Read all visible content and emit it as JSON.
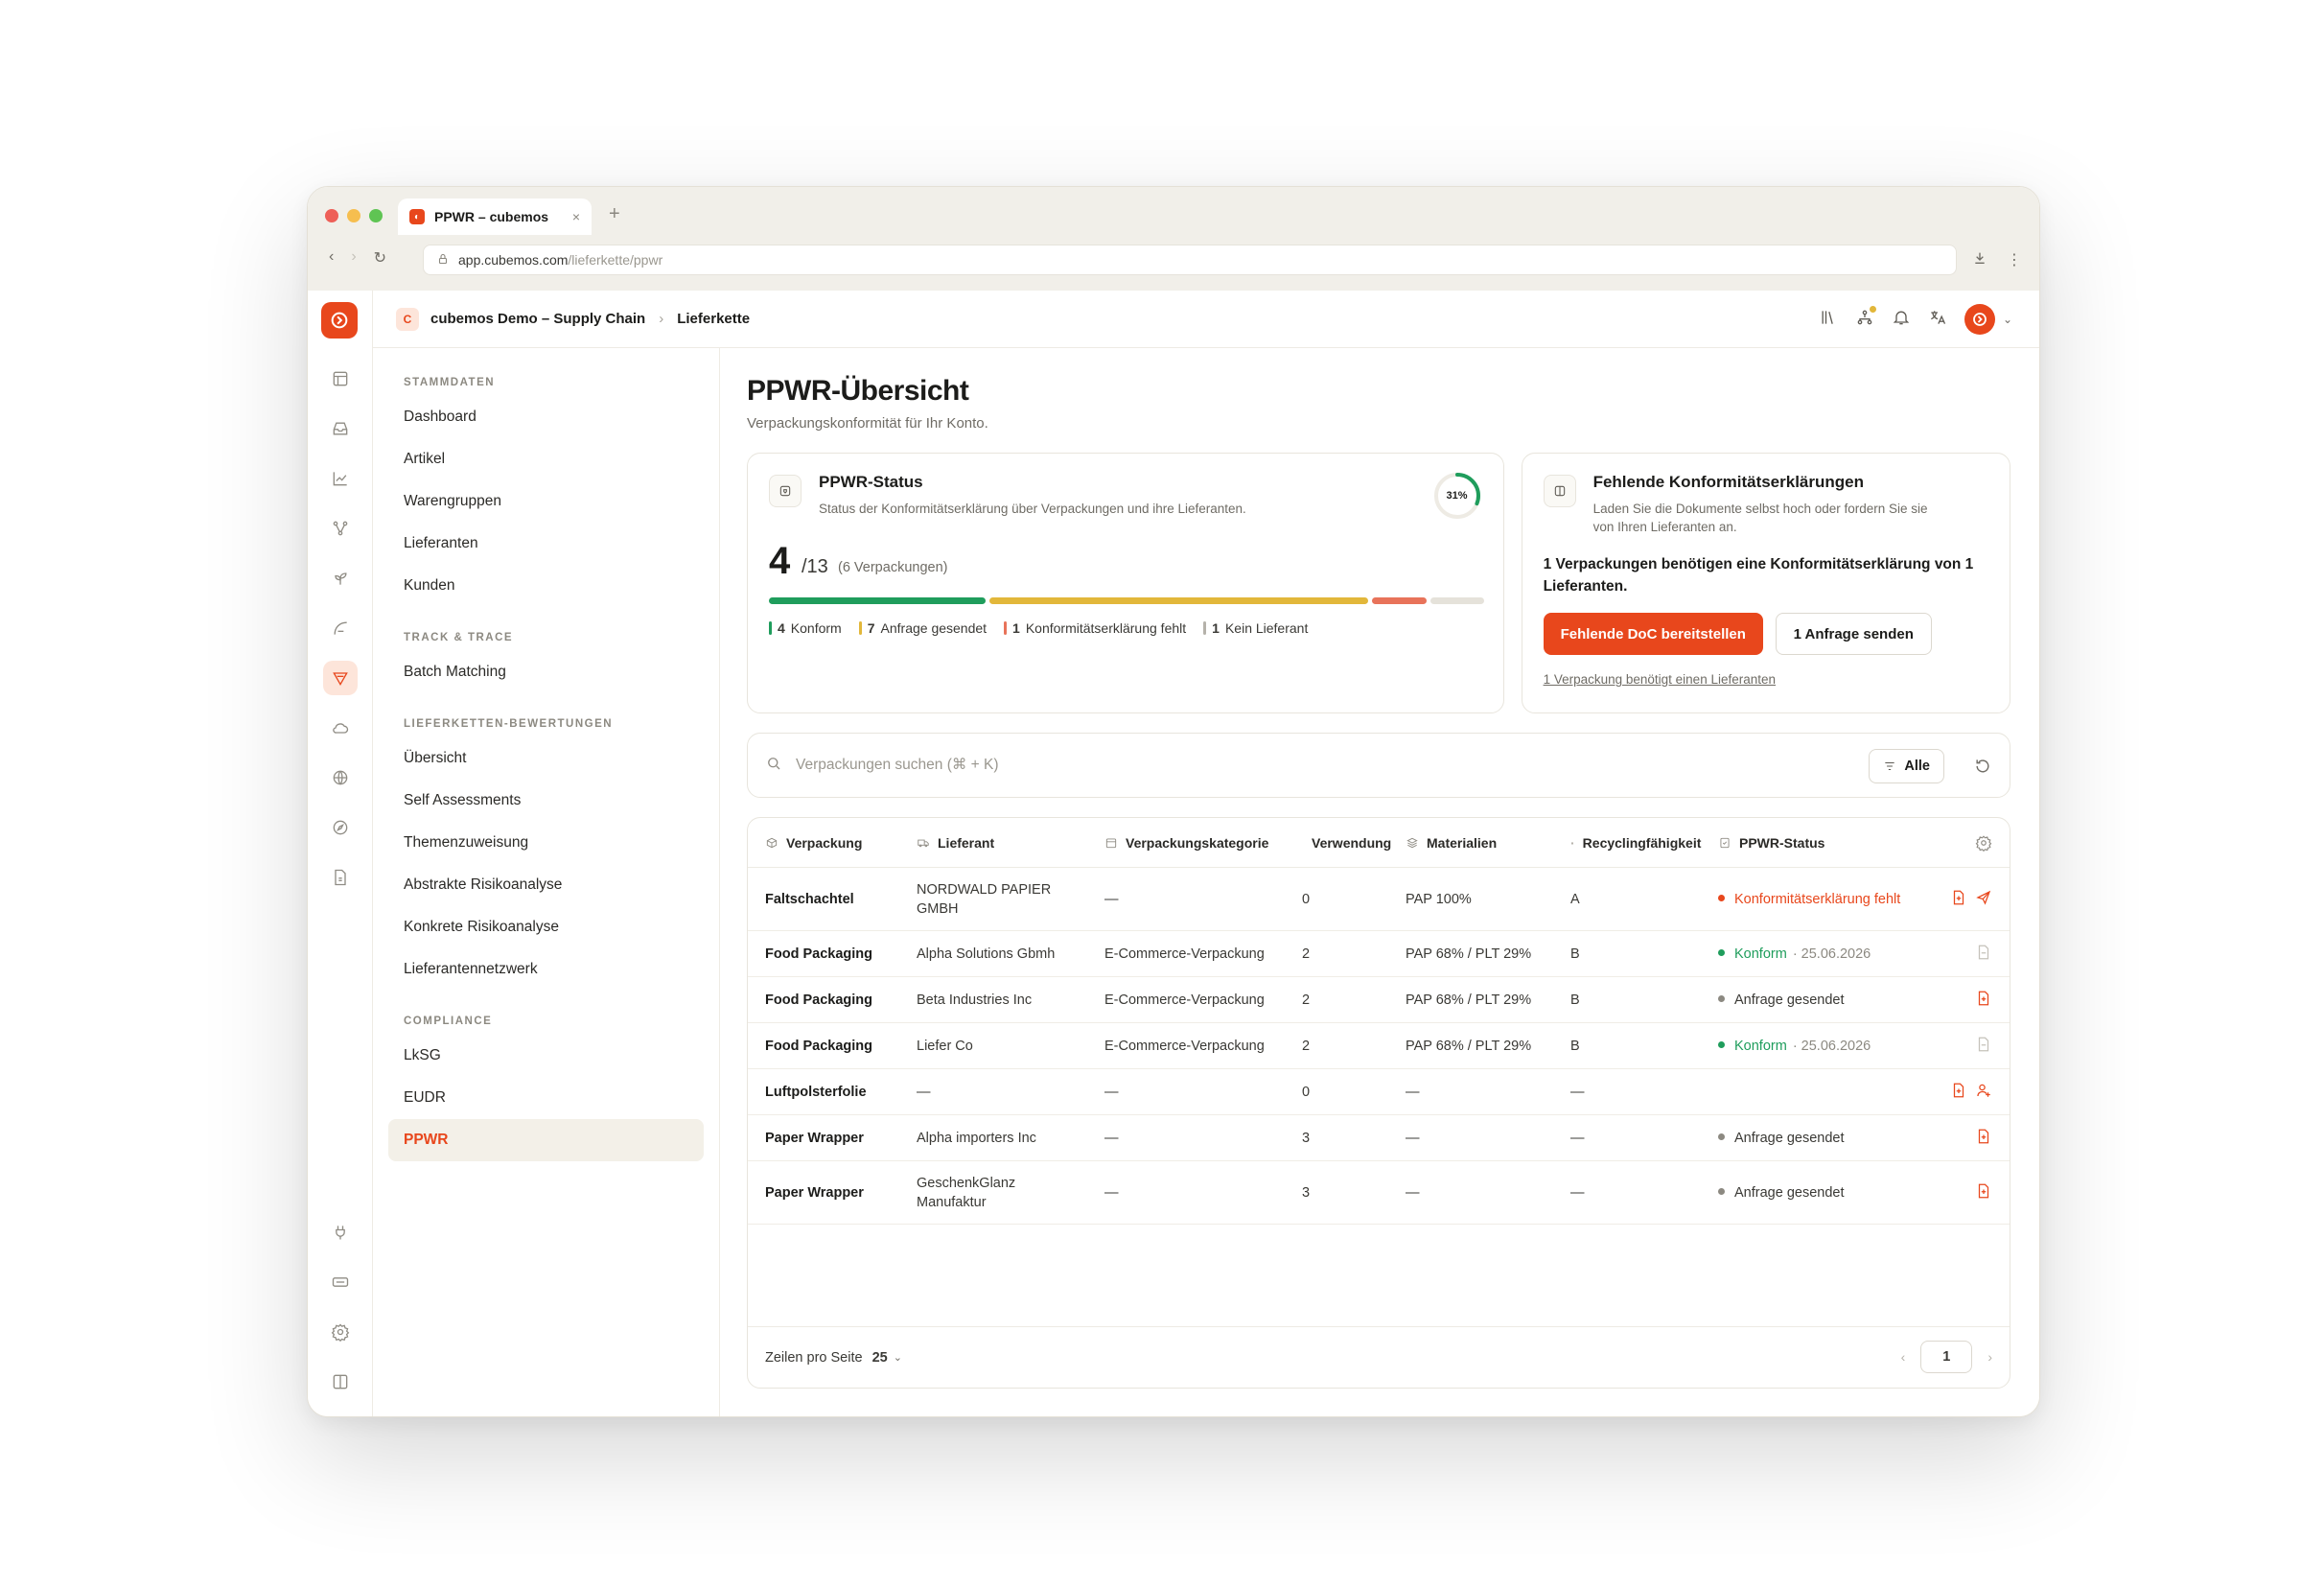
{
  "browser": {
    "tab_title": "PPWR – cubemos",
    "tab_close": "×",
    "new_tab": "+",
    "url_host": "app.cubemos.com",
    "url_path": "/lieferkette/ppwr"
  },
  "topbar": {
    "org_badge": "C",
    "org_name": "cubemos Demo – Supply Chain",
    "breadcrumb_sep": "›",
    "breadcrumb_current": "Lieferkette"
  },
  "menu": {
    "sections": [
      {
        "title": "STAMMDATEN",
        "items": [
          "Dashboard",
          "Artikel",
          "Warengruppen",
          "Lieferanten",
          "Kunden"
        ]
      },
      {
        "title": "TRACK & TRACE",
        "items": [
          "Batch Matching"
        ]
      },
      {
        "title": "LIEFERKETTEN-BEWERTUNGEN",
        "items": [
          "Übersicht",
          "Self Assessments",
          "Themenzuweisung",
          "Abstrakte Risikoanalyse",
          "Konkrete Risikoanalyse",
          "Lieferantennetzwerk"
        ]
      },
      {
        "title": "COMPLIANCE",
        "items": [
          "LkSG",
          "EUDR",
          "PPWR"
        ]
      }
    ],
    "active_item": "PPWR"
  },
  "page": {
    "title": "PPWR-Übersicht",
    "subtitle": "Verpackungskonformität für Ihr Konto."
  },
  "status_card": {
    "title": "PPWR-Status",
    "description": "Status der Konformitätserklärung über Verpackungen und ihre Lieferanten.",
    "ring_label": "31%",
    "ring_fraction": 0.31,
    "big_number": "4",
    "total": "/13",
    "count_note": "(6 Verpackungen)",
    "segments": [
      {
        "label": "Konform",
        "count": "4",
        "color": "#1f9d5c",
        "weight": 4
      },
      {
        "label": "Anfrage gesendet",
        "count": "7",
        "color": "#e2b73a",
        "weight": 7
      },
      {
        "label": "Konformitätserklärung fehlt",
        "count": "1",
        "color": "#e8735a",
        "weight": 1
      },
      {
        "label": "Kein Lieferant",
        "count": "1",
        "color": "#e5e2da",
        "weight": 1
      }
    ]
  },
  "missing_card": {
    "title": "Fehlende Konformitätserklärungen",
    "description_line1": "Laden Sie die Dokumente selbst hoch oder fordern Sie sie",
    "description_line2": "von Ihren Lieferanten an.",
    "bold_text": "1 Verpackungen benötigen eine Konformitätserklärung von 1 Lieferanten.",
    "primary_button": "Fehlende DoC bereitstellen",
    "secondary_button": "1 Anfrage senden",
    "link": "1 Verpackung benötigt einen Lieferanten"
  },
  "search": {
    "placeholder": "Verpackungen suchen (⌘ + K)",
    "filter_label": "Alle"
  },
  "table": {
    "columns": [
      "Verpackung",
      "Lieferant",
      "Verpackungskategorie",
      "Verwendung",
      "Materialien",
      "Recyclingfähigkeit",
      "PPWR-Status"
    ],
    "rows": [
      {
        "packaging": "Faltschachtel",
        "supplier": "NORDWALD PAPIER GMBH",
        "category": "—",
        "usage": "0",
        "materials": "PAP 100%",
        "recycling": "A",
        "status": "Konformitätserklärung fehlt",
        "status_type": "red",
        "date": ""
      },
      {
        "packaging": "Food Packaging",
        "supplier": "Alpha Solutions Gbmh",
        "category": "E-Commerce-Verpackung",
        "usage": "2",
        "materials": "PAP 68% / PLT 29%",
        "recycling": "B",
        "status": "Konform",
        "status_type": "green",
        "date": "· 25.06.2026"
      },
      {
        "packaging": "Food Packaging",
        "supplier": "Beta Industries Inc",
        "category": "E-Commerce-Verpackung",
        "usage": "2",
        "materials": "PAP 68% / PLT 29%",
        "recycling": "B",
        "status": "Anfrage gesendet",
        "status_type": "grey",
        "date": ""
      },
      {
        "packaging": "Food Packaging",
        "supplier": "Liefer Co",
        "category": "E-Commerce-Verpackung",
        "usage": "2",
        "materials": "PAP 68% / PLT 29%",
        "recycling": "B",
        "status": "Konform",
        "status_type": "green",
        "date": "· 25.06.2026"
      },
      {
        "packaging": "Luftpolsterfolie",
        "supplier": "—",
        "category": "—",
        "usage": "0",
        "materials": "—",
        "recycling": "—",
        "status": "",
        "status_type": "none",
        "date": ""
      },
      {
        "packaging": "Paper Wrapper",
        "supplier": "Alpha importers Inc",
        "category": "—",
        "usage": "3",
        "materials": "—",
        "recycling": "—",
        "status": "Anfrage gesendet",
        "status_type": "grey",
        "date": ""
      },
      {
        "packaging": "Paper Wrapper",
        "supplier": "GeschenkGlanz Manufaktur",
        "category": "—",
        "usage": "3",
        "materials": "—",
        "recycling": "—",
        "status": "Anfrage gesendet",
        "status_type": "grey",
        "date": ""
      }
    ]
  },
  "footer": {
    "rows_per_page_label": "Zeilen pro Seite",
    "rows_per_page_value": "25",
    "prev": "‹",
    "next": "›",
    "page": "1"
  },
  "colors": {
    "accent": "#e8471c",
    "green": "#1f9d5c",
    "yellow": "#e2b73a",
    "grey": "#8c8981"
  }
}
